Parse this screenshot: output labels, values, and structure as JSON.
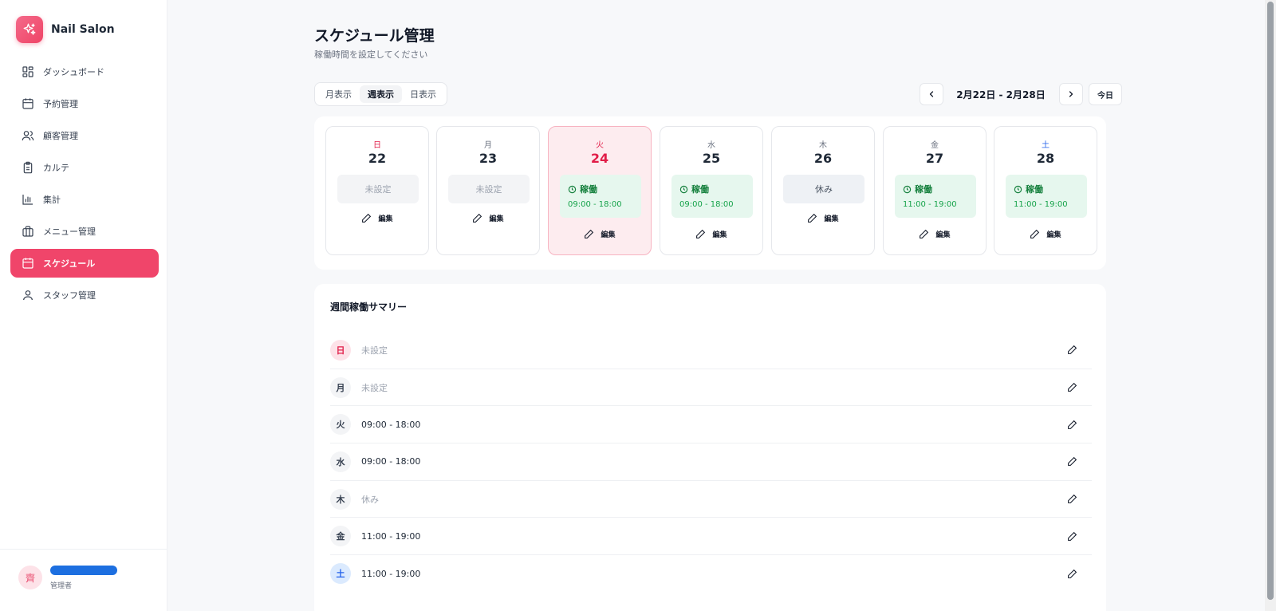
{
  "brand": {
    "name": "Nail Salon",
    "logo_icon": "sparkles-icon"
  },
  "sidebar": {
    "items": [
      {
        "label": "ダッシュボード",
        "icon": "dashboard-icon",
        "active": false
      },
      {
        "label": "予約管理",
        "icon": "calendar-icon",
        "active": false
      },
      {
        "label": "顧客管理",
        "icon": "users-icon",
        "active": false
      },
      {
        "label": "カルテ",
        "icon": "clipboard-icon",
        "active": false
      },
      {
        "label": "集計",
        "icon": "bar-chart-icon",
        "active": false
      },
      {
        "label": "メニュー管理",
        "icon": "briefcase-icon",
        "active": false
      },
      {
        "label": "スケジュール",
        "icon": "calendar-icon",
        "active": true
      },
      {
        "label": "スタッフ管理",
        "icon": "user-icon",
        "active": false
      }
    ]
  },
  "user": {
    "avatar_text": "齊",
    "role": "管理者"
  },
  "header": {
    "title": "スケジュール管理",
    "subtitle": "稼働時間を設定してください"
  },
  "view_toggle": {
    "month": "月表示",
    "week": "週表示",
    "day": "日表示",
    "selected": "week"
  },
  "date_nav": {
    "range": "2月22日 - 2月28日",
    "today": "今日"
  },
  "week": {
    "edit_label": "編集",
    "days": [
      {
        "weekday": "日",
        "date": "22",
        "status": "未設定"
      },
      {
        "weekday": "月",
        "date": "23",
        "status": "未設定"
      },
      {
        "weekday": "火",
        "date": "24",
        "status": "稼働",
        "time": "09:00 - 18:00"
      },
      {
        "weekday": "水",
        "date": "25",
        "status": "稼働",
        "time": "09:00 - 18:00"
      },
      {
        "weekday": "木",
        "date": "26",
        "status": "休み"
      },
      {
        "weekday": "金",
        "date": "27",
        "status": "稼働",
        "time": "11:00 - 19:00"
      },
      {
        "weekday": "土",
        "date": "28",
        "status": "稼働",
        "time": "11:00 - 19:00"
      }
    ]
  },
  "summary": {
    "title": "週間稼働サマリー",
    "rows": [
      {
        "weekday": "日",
        "value": "未設定"
      },
      {
        "weekday": "月",
        "value": "未設定"
      },
      {
        "weekday": "火",
        "value": "09:00 - 18:00"
      },
      {
        "weekday": "水",
        "value": "09:00 - 18:00"
      },
      {
        "weekday": "木",
        "value": "休み"
      },
      {
        "weekday": "金",
        "value": "11:00 - 19:00"
      },
      {
        "weekday": "土",
        "value": "11:00 - 19:00"
      }
    ]
  },
  "colors": {
    "accent": "#f0456a",
    "working": "#15803d",
    "sunday": "#e11d48",
    "saturday": "#2563eb"
  }
}
